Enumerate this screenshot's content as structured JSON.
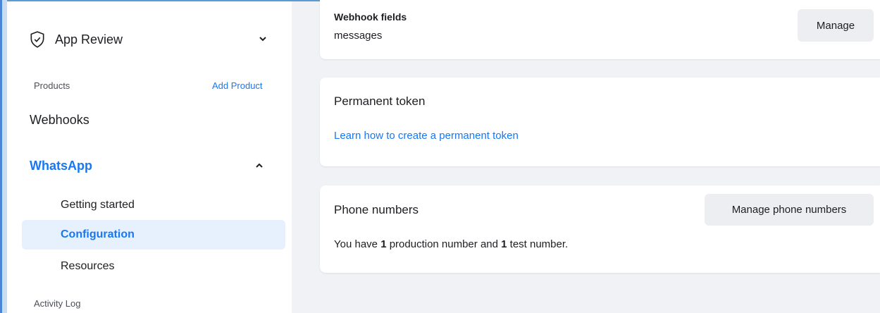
{
  "sidebar": {
    "app_review": {
      "label": "App Review",
      "icon": "shield-check-icon"
    },
    "products_label": "Products",
    "add_product": "Add Product",
    "webhooks": "Webhooks",
    "whatsapp": "WhatsApp",
    "whatsapp_items": {
      "getting_started": "Getting started",
      "configuration": "Configuration",
      "resources": "Resources"
    },
    "activity_log": "Activity Log"
  },
  "main": {
    "webhook_card": {
      "title": "Webhook fields",
      "value": "messages",
      "manage_button": "Manage"
    },
    "permanent_token_card": {
      "title": "Permanent token",
      "link": "Learn how to create a permanent token"
    },
    "phone_numbers_card": {
      "title": "Phone numbers",
      "manage_button": "Manage phone numbers",
      "text_prefix": "You have ",
      "production_count": "1",
      "text_middle": " production number and ",
      "test_count": "1",
      "text_suffix": " test number."
    }
  },
  "colors": {
    "accent": "#1877f2",
    "selected_bg": "#e7f0fd",
    "page_bg": "#f0f2f5"
  }
}
